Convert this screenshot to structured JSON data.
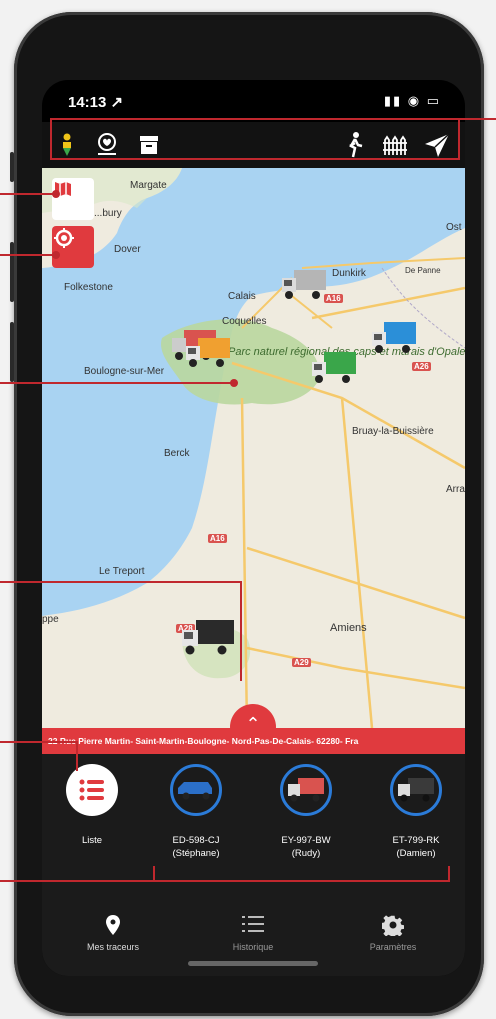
{
  "status": {
    "time": "14:13 ↗",
    "icons": "▮▮ ◉ ▭"
  },
  "toolbar": {
    "left_icons": [
      "person-download-icon",
      "heart-pin-icon",
      "archive-icon"
    ],
    "right_icons": [
      "walking-person-icon",
      "fence-icon",
      "send-icon"
    ]
  },
  "map": {
    "places": {
      "margate": "Margate",
      "canterbury": "...bury",
      "dover": "Dover",
      "folkestone": "Folkestone",
      "calais": "Calais",
      "coquelles": "Coquelles",
      "dunkirk": "Dunkirk",
      "de_panne": "De Panne",
      "boulogne": "Boulogne-sur-Mer",
      "park": "Parc naturel régional des caps et marais d'Opale",
      "berck": "Berck",
      "bruay": "Bruay-la-Buissière",
      "arras": "Arra",
      "le_treport": "Le Treport",
      "dieppe": "ppe",
      "amiens": "Amiens",
      "ost": "Ost"
    },
    "roads": {
      "a16_top": "A16",
      "a26": "A26",
      "a16_mid": "A16",
      "a28": "A28",
      "a29": "A29",
      "a25": "A25"
    }
  },
  "address": "22 Rue Pierre Martin- Saint-Martin-Boulogne- Nord-Pas-De-Calais- 62280- Fra",
  "trackers": [
    {
      "label": "Liste",
      "sub": ""
    },
    {
      "label": "ED-598-CJ",
      "sub": "(Stéphane)"
    },
    {
      "label": "EY-997-BW",
      "sub": "(Rudy)"
    },
    {
      "label": "ET-799-RK",
      "sub": "(Damien)"
    }
  ],
  "tabs": [
    {
      "label": "Mes traceurs",
      "icon": "pin-icon"
    },
    {
      "label": "Historique",
      "icon": "list-icon"
    },
    {
      "label": "Paramètres",
      "icon": "gear-icon"
    }
  ],
  "colors": {
    "accent": "#e03a3e",
    "callout": "#c0282e",
    "sea": "#a9d3f2",
    "land": "#efebdf",
    "park": "#b9d79e"
  }
}
